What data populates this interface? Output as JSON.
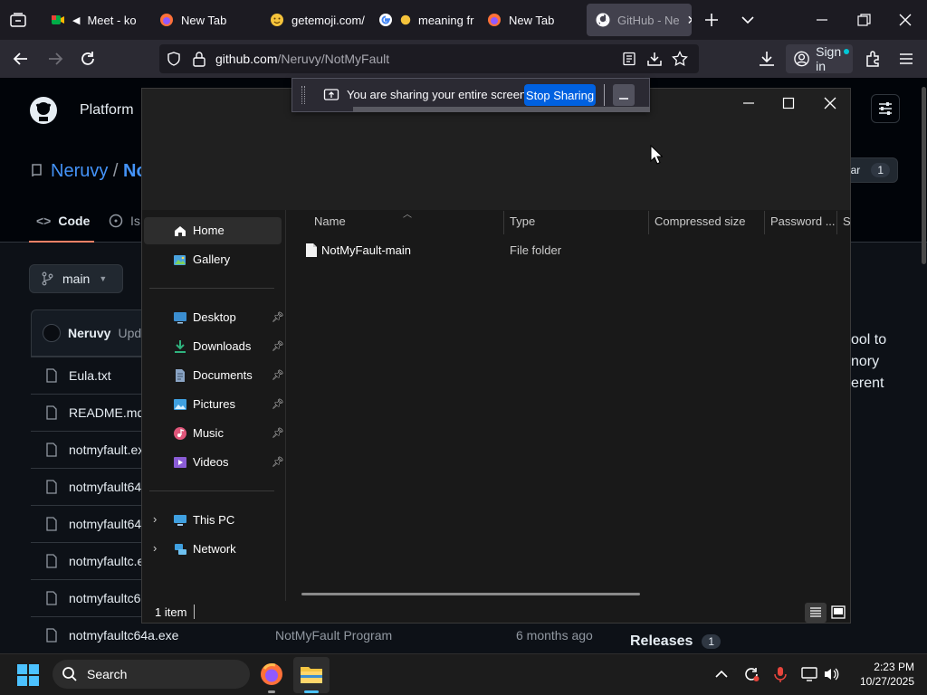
{
  "browser": {
    "tabs": [
      {
        "label": "Meet - ko",
        "icon": "google-meet-icon",
        "active": false
      },
      {
        "label": "New Tab",
        "icon": "firefox-icon",
        "active": false
      },
      {
        "label": "getemoji.com/",
        "icon": "emoji-icon",
        "active": false
      },
      {
        "label": "meaning fr",
        "icon": "google-icon",
        "active": false
      },
      {
        "label": "New Tab",
        "icon": "firefox-icon",
        "active": false
      },
      {
        "label": "GitHub - Ne",
        "icon": "github-icon",
        "active": true
      }
    ],
    "url_host": "github.com",
    "url_path": "/Neruvy/NotMyFault",
    "sign_in_label": "Sign in"
  },
  "share_bar": {
    "message": "You are sharing your entire screen.",
    "stop_label": "Stop Sharing"
  },
  "github": {
    "nav_platform": "Platform",
    "owner": "Neruvy",
    "repo_fragment": "No",
    "tab_code": "Code",
    "tab_issues_fragment": "Is",
    "branch": "main",
    "star_fragment": "tar",
    "star_count": "1",
    "commit_author": "Neruvy",
    "commit_text_fragment": "Upd",
    "files": [
      "Eula.txt",
      "README.md",
      "notmyfault.ex",
      "notmyfault64",
      "notmyfault64",
      "notmyfaultc.e",
      "notmyfaultc6",
      "notmyfaultc64a.exe"
    ],
    "last_file_message": "NotMyFault Program",
    "last_file_time": "6 months ago",
    "about_fragments": [
      "ool to",
      "nory",
      "erent"
    ],
    "releases_label": "Releases",
    "releases_count": "1"
  },
  "explorer": {
    "nav": {
      "home": "Home",
      "gallery": "Gallery",
      "desktop": "Desktop",
      "downloads": "Downloads",
      "documents": "Documents",
      "pictures": "Pictures",
      "music": "Music",
      "videos": "Videos",
      "this_pc": "This PC",
      "network": "Network"
    },
    "columns": {
      "name": "Name",
      "type": "Type",
      "compressed": "Compressed size",
      "password": "Password ...",
      "size_fragment": "Si"
    },
    "rows": [
      {
        "name": "NotMyFault-main",
        "type": "File folder"
      }
    ],
    "status": "1 item"
  },
  "taskbar": {
    "search_label": "Search",
    "time": "2:23 PM",
    "date": "10/27/2025"
  }
}
